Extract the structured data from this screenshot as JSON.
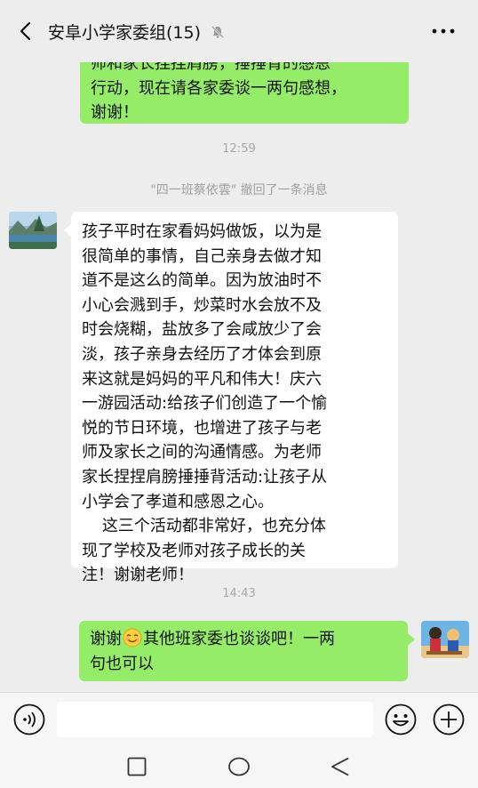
{
  "header": {
    "title": "安阜小学家委组(15)"
  },
  "messages": {
    "m1": {
      "text": "师和家长捏捏肩膀，捶捶背的感恩\n行动，现在请各家委谈一两句感想，\n谢谢！"
    },
    "time1": "12:59",
    "recall": "\"四一班蔡依雲\" 撤回了一条消息",
    "m2": {
      "text": "孩子平时在家看妈妈做饭，以为是\n很简单的事情，自己亲身去做才知\n道不是这么的简单。因为放油时不\n小心会溅到手，炒菜时水会放不及\n时会烧糊，盐放多了会咸放少了会\n淡，孩子亲身去经历了才体会到原\n来这就是妈妈的平凡和伟大！庆六\n一游园活动:给孩子们创造了一个愉\n悦的节日环境，也增进了孩子与老\n师及家长之间的沟通情感。为老师\n家长捏捏肩膀捶捶背活动:让孩子从\n小学会了孝道和感恩之心。\n    这三个活动都非常好，也充分体\n现了学校及老师对孩子成长的关\n注！谢谢老师！"
    },
    "time2": "14:43",
    "m3": {
      "text_before": "谢谢",
      "text_after": "其他班家委也谈谈吧！一两\n句也可以"
    }
  },
  "icons": {
    "back": "chevron-left-icon",
    "mute": "bell-muted-icon",
    "more": "more-dots-icon",
    "voice": "voice-icon",
    "emoji": "emoji-icon",
    "plus": "plus-icon",
    "smile": "smile-emoji-icon"
  },
  "input": {
    "value": ""
  },
  "colors": {
    "sent_bubble": "#95ec69",
    "received_bubble": "#ffffff",
    "background": "#ededed"
  }
}
